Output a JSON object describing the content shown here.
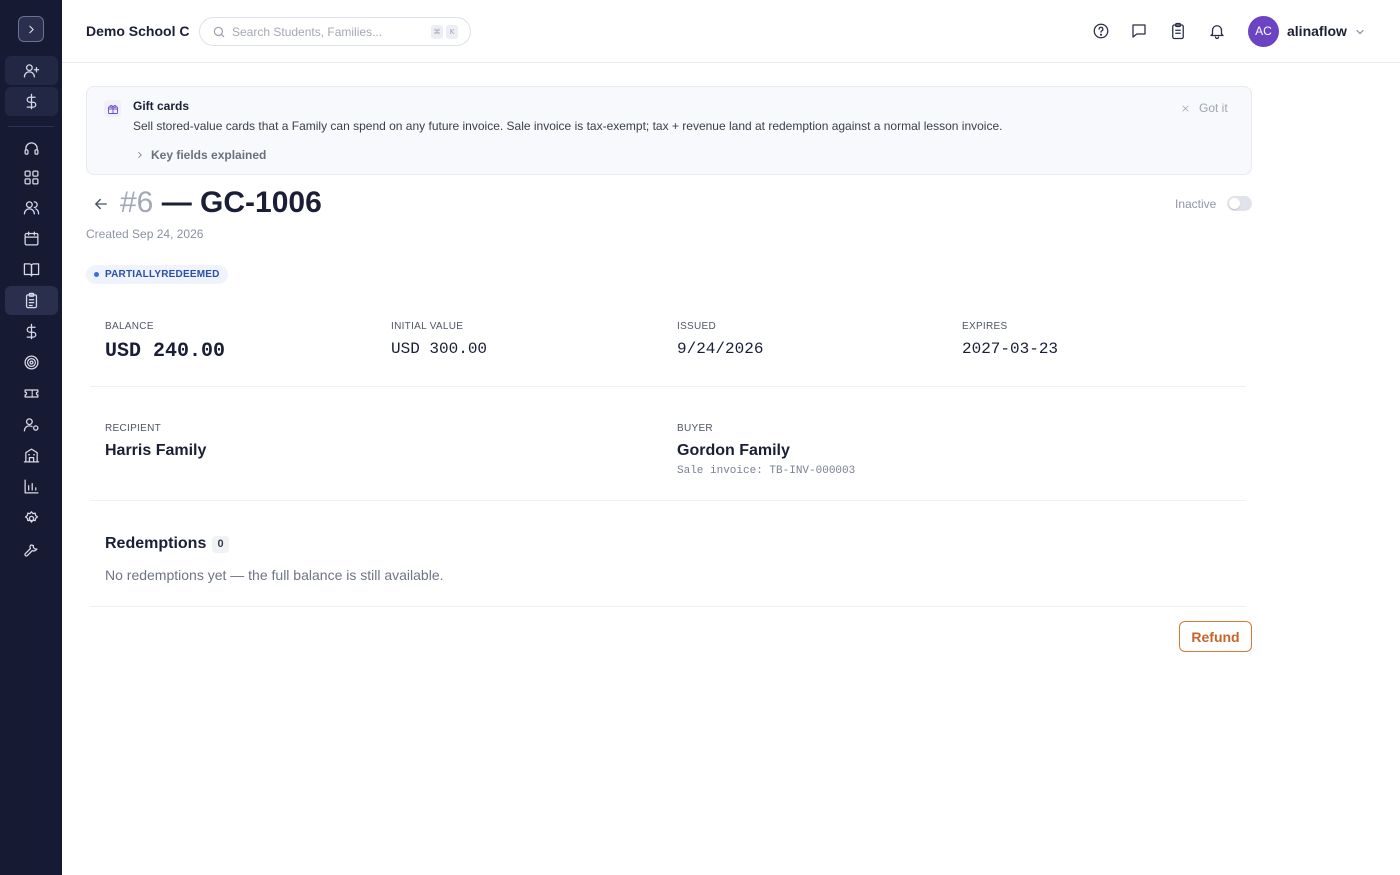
{
  "sidebar": {
    "expand_icon": "chevron-right-icon",
    "items": [
      {
        "name": "add-user-icon",
        "state": "tinted"
      },
      {
        "name": "dollar-icon",
        "state": "tinted"
      },
      {
        "name": "headset-icon",
        "state": "normal"
      },
      {
        "name": "dashboard-icon",
        "state": "normal"
      },
      {
        "name": "users-icon",
        "state": "normal"
      },
      {
        "name": "calendar-icon",
        "state": "normal"
      },
      {
        "name": "book-icon",
        "state": "normal"
      },
      {
        "name": "clipboard-icon",
        "state": "active"
      },
      {
        "name": "dollar-icon",
        "state": "normal"
      },
      {
        "name": "target-icon",
        "state": "normal"
      },
      {
        "name": "ticket-icon",
        "state": "normal"
      },
      {
        "name": "user-settings-icon",
        "state": "normal"
      },
      {
        "name": "building-icon",
        "state": "normal"
      },
      {
        "name": "bar-chart-icon",
        "state": "normal"
      },
      {
        "name": "gear-icon",
        "state": "normal"
      },
      {
        "name": "wrench-icon",
        "state": "normal"
      }
    ]
  },
  "header": {
    "school_name": "Demo School C",
    "search_placeholder": "Search Students, Families...",
    "shortcut_keys": [
      "⌘",
      "K"
    ],
    "icons": [
      "help-circle-icon",
      "message-icon",
      "clipboard-icon",
      "bell-icon"
    ],
    "user": {
      "initials": "AC",
      "name": "alinaflow",
      "avatar_color": "#6a44c2"
    }
  },
  "banner": {
    "title": "Gift cards",
    "description": "Sell stored-value cards that a Family can spend on any future invoice. Sale invoice is tax-exempt; tax + revenue land at redemption against a normal lesson invoice.",
    "key_fields_label": "Key fields explained",
    "dismiss_label": "Got it"
  },
  "page": {
    "number": "#6",
    "code": "— GC-1006",
    "created_label": "Created",
    "created_date": "Sep 24, 2026",
    "status_toggle_label": "Inactive",
    "status_badge": "PARTIALLYREDEEMED"
  },
  "stats": {
    "balance": {
      "label": "BALANCE",
      "value": "USD 240.00"
    },
    "initial_value": {
      "label": "INITIAL VALUE",
      "value": "USD 300.00"
    },
    "issued": {
      "label": "ISSUED",
      "value": "9/24/2026"
    },
    "expires": {
      "label": "EXPIRES",
      "value": "2027-03-23"
    }
  },
  "parties": {
    "recipient": {
      "label": "RECIPIENT",
      "name": "Harris Family"
    },
    "buyer": {
      "label": "BUYER",
      "name": "Gordon Family",
      "sale_invoice": "Sale invoice: TB-INV-000003"
    }
  },
  "redemptions": {
    "title": "Redemptions",
    "count": "0",
    "empty_message": "No redemptions yet — the full balance is still available."
  },
  "actions": {
    "refund_label": "Refund"
  },
  "colors": {
    "sidebar_bg": "#161a33",
    "accent_purple": "#6a44c2",
    "badge_blue": "#2b4fa8",
    "refund_orange": "#c8642a"
  }
}
